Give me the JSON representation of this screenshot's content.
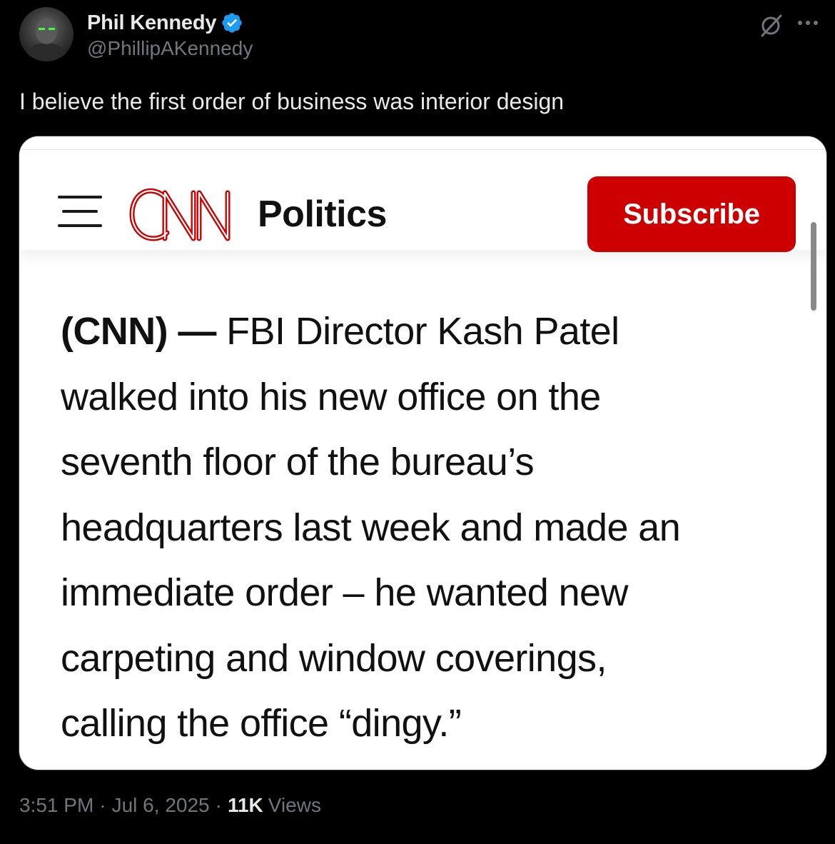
{
  "author": {
    "name": "Phil Kennedy",
    "handle": "@PhillipAKennedy",
    "verified": true
  },
  "tweet": {
    "text": "I believe the first order of business was interior design"
  },
  "embedded_screenshot": {
    "section": "Politics",
    "subscribe_label": "Subscribe",
    "article_dateline": "(CNN) —",
    "article_lines": [
      "FBI Director Kash Patel",
      "walked into his new office on the",
      "seventh floor of the bureau’s",
      "headquarters last week and made an",
      "immediate order – he wanted new",
      "carpeting and window coverings,",
      "calling the office “dingy.”"
    ]
  },
  "meta": {
    "time": "3:51 PM",
    "separator": "·",
    "date": "Jul 6, 2025",
    "views_count": "11K",
    "views_label": "Views"
  },
  "colors": {
    "background": "#000000",
    "primary_text": "#e7e9ea",
    "secondary_text": "#71767b",
    "verified_blue": "#1d9bf0",
    "cnn_red": "#cc0000"
  },
  "icons": [
    "verified-badge-icon",
    "grok-icon",
    "more-icon",
    "hamburger-menu-icon",
    "cnn-logo"
  ]
}
